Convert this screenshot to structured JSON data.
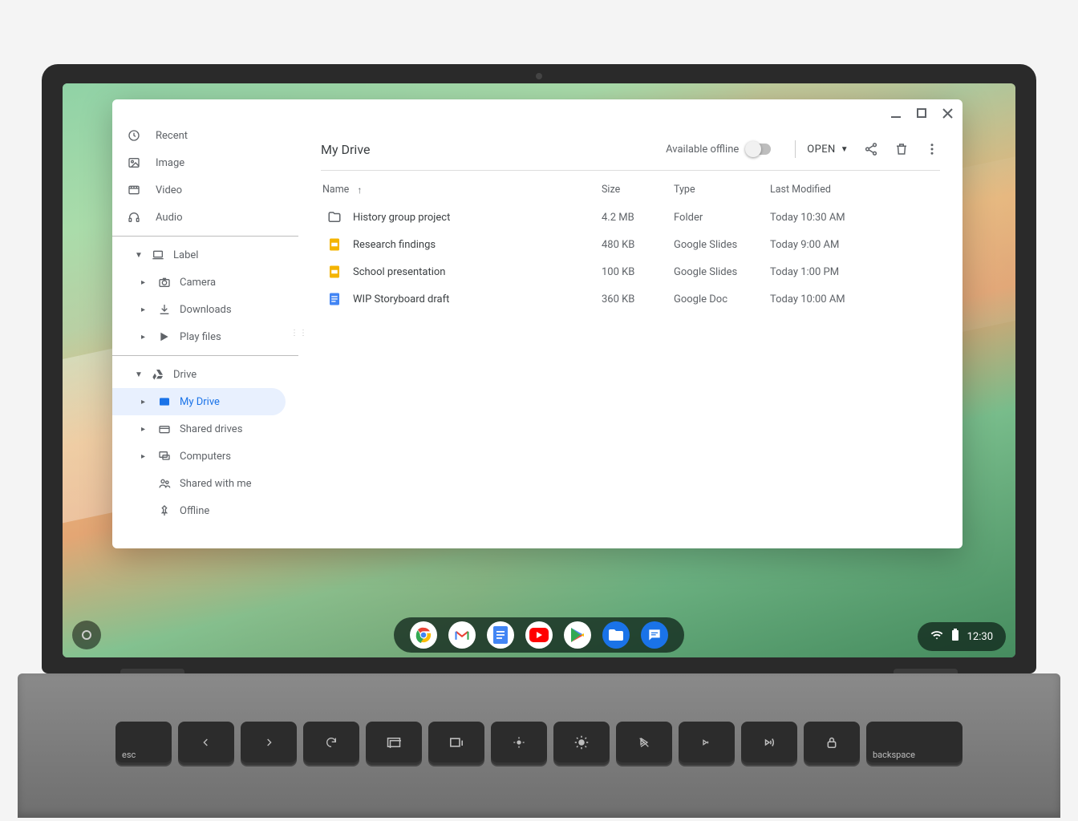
{
  "window": {
    "title": "My Drive",
    "offline_label": "Available offline",
    "open_label": "OPEN"
  },
  "sidebar": {
    "recent": "Recent",
    "image": "Image",
    "video": "Video",
    "audio": "Audio",
    "label_section": "Label",
    "camera": "Camera",
    "downloads": "Downloads",
    "play_files": "Play files",
    "drive_section": "Drive",
    "my_drive": "My Drive",
    "shared_drives": "Shared drives",
    "computers": "Computers",
    "shared_with_me": "Shared with me",
    "offline": "Offline"
  },
  "columns": {
    "name": "Name",
    "size": "Size",
    "type": "Type",
    "modified": "Last Modified"
  },
  "files": [
    {
      "icon": "folder",
      "name": "History group project",
      "size": "4.2 MB",
      "type": "Folder",
      "modified": "Today 10:30 AM"
    },
    {
      "icon": "slides",
      "name": "Research findings",
      "size": "480 KB",
      "type": "Google Slides",
      "modified": "Today 9:00 AM"
    },
    {
      "icon": "slides",
      "name": "School presentation",
      "size": "100 KB",
      "type": "Google Slides",
      "modified": "Today 1:00 PM"
    },
    {
      "icon": "doc",
      "name": "WIP Storyboard draft",
      "size": "360 KB",
      "type": "Google Doc",
      "modified": "Today 10:00 AM"
    }
  ],
  "shelf": {
    "time": "12:30"
  },
  "keys": [
    "esc",
    "",
    "",
    "",
    "",
    "",
    "",
    "",
    "",
    "",
    "",
    "",
    "backspace"
  ]
}
